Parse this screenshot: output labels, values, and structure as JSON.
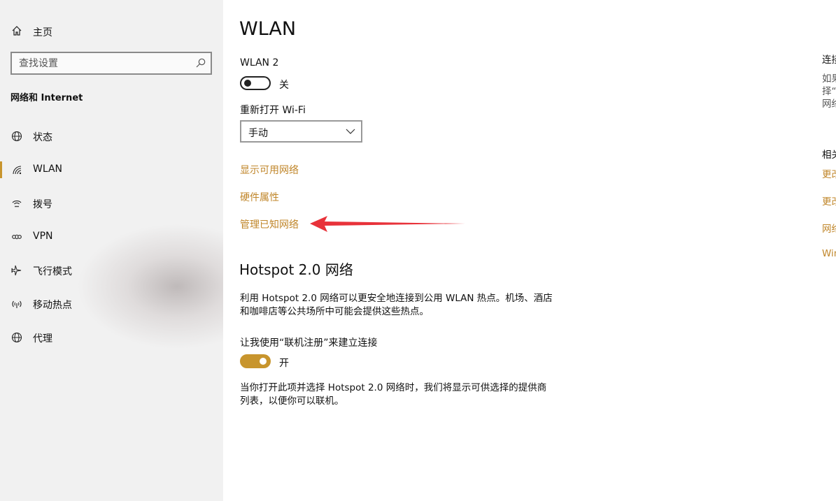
{
  "sidebar": {
    "home_label": "主页",
    "search_placeholder": "查找设置",
    "section_title": "网络和 Internet",
    "items": [
      {
        "label": "状态",
        "icon": "globe-icon"
      },
      {
        "label": "WLAN",
        "icon": "wifi-icon",
        "selected": true
      },
      {
        "label": "拨号",
        "icon": "dialup-icon"
      },
      {
        "label": "VPN",
        "icon": "vpn-icon"
      },
      {
        "label": "飞行模式",
        "icon": "airplane-icon"
      },
      {
        "label": "移动热点",
        "icon": "hotspot-icon"
      },
      {
        "label": "代理",
        "icon": "globe-icon"
      }
    ]
  },
  "main": {
    "title": "WLAN",
    "adapter_name": "WLAN 2",
    "wifi_toggle_state": "关",
    "reopen_label": "重新打开 Wi-Fi",
    "reopen_value": "手动",
    "links": {
      "show_networks": "显示可用网络",
      "hardware_properties": "硬件属性",
      "manage_known": "管理已知网络"
    },
    "hotspot": {
      "heading": "Hotspot 2.0 网络",
      "description": "利用 Hotspot 2.0 网络可以更安全地连接到公用 WLAN 热点。机场、酒店和咖啡店等公共场所中可能会提供这些热点。",
      "online_signup_label": "让我使用“联机注册”来建立连接",
      "toggle_state": "开",
      "footnote": "当你打开此项并选择 Hotspot 2.0 网络时，我们将显示可供选择的提供商列表，以便你可以联机。"
    }
  },
  "right_column": {
    "head1": "连接",
    "desc": [
      "如果",
      "择“",
      "网络"
    ],
    "head2": "相关",
    "links": [
      "更改",
      "更改",
      "网络",
      "Win"
    ]
  },
  "colors": {
    "accent": "#c8952d",
    "link": "#c0862a",
    "arrow": "#e8323a"
  }
}
